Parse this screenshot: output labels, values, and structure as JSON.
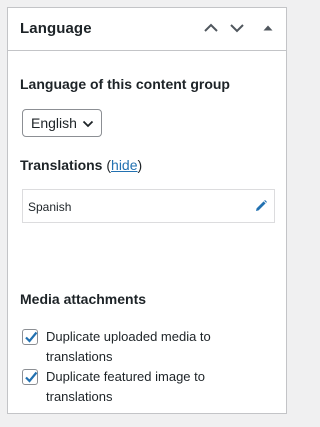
{
  "panel": {
    "title": "Language",
    "move_up_label": "Move up",
    "move_down_label": "Move down",
    "toggle_label": "Toggle panel"
  },
  "language": {
    "heading": "Language of this content group",
    "selected": "English"
  },
  "translations": {
    "heading": "Translations",
    "hide_link": "hide",
    "open_paren": "(",
    "close_paren": ")",
    "items": [
      {
        "name": "Spanish"
      }
    ]
  },
  "media": {
    "heading": "Media attachments",
    "options": [
      {
        "label": "Duplicate uploaded media to translations",
        "checked": true
      },
      {
        "label": "Duplicate featured image to translations",
        "checked": true
      }
    ]
  },
  "colors": {
    "accent": "#2271b1",
    "border": "#c3c4c7",
    "background": "#f0f0f1",
    "text": "#1d2327"
  },
  "icons": {
    "move_up": "chevron-up-icon",
    "move_down": "chevron-down-icon",
    "toggle": "triangle-up-icon",
    "select": "chevron-down-icon",
    "edit": "pencil-icon",
    "check": "checkmark-icon"
  }
}
